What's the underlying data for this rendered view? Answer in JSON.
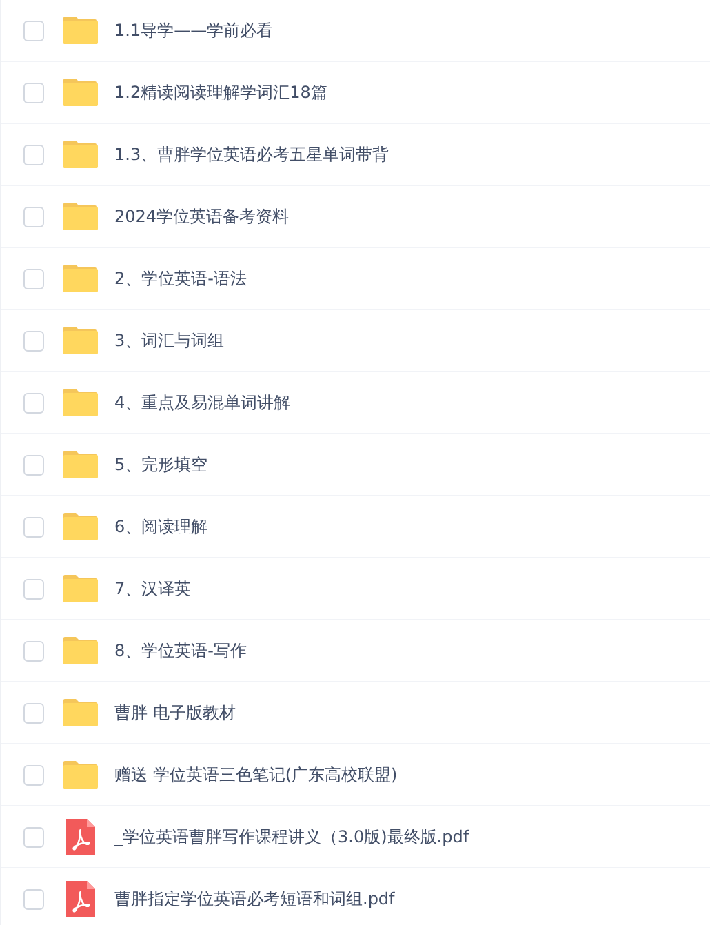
{
  "files": [
    {
      "kind": "folder",
      "name": "1.1导学——学前必看",
      "checked": false
    },
    {
      "kind": "folder",
      "name": "1.2精读阅读理解学词汇18篇",
      "checked": false
    },
    {
      "kind": "folder",
      "name": "1.3、曹胖学位英语必考五星单词带背",
      "checked": false
    },
    {
      "kind": "folder",
      "name": "2024学位英语备考资料",
      "checked": false
    },
    {
      "kind": "folder",
      "name": "2、学位英语-语法",
      "checked": false
    },
    {
      "kind": "folder",
      "name": "3、词汇与词组",
      "checked": false
    },
    {
      "kind": "folder",
      "name": "4、重点及易混单词讲解",
      "checked": false
    },
    {
      "kind": "folder",
      "name": "5、完形填空",
      "checked": false
    },
    {
      "kind": "folder",
      "name": "6、阅读理解",
      "checked": false
    },
    {
      "kind": "folder",
      "name": "7、汉译英",
      "checked": false
    },
    {
      "kind": "folder",
      "name": "8、学位英语-写作",
      "checked": false
    },
    {
      "kind": "folder",
      "name": "曹胖 电子版教材",
      "checked": false
    },
    {
      "kind": "folder",
      "name": "赠送 学位英语三色笔记(广东高校联盟)",
      "checked": false
    },
    {
      "kind": "pdf",
      "name": "_学位英语曹胖写作课程讲义（3.0版)最终版.pdf",
      "checked": false
    },
    {
      "kind": "pdf",
      "name": "曹胖指定学位英语必考短语和词组.pdf",
      "checked": false
    }
  ]
}
